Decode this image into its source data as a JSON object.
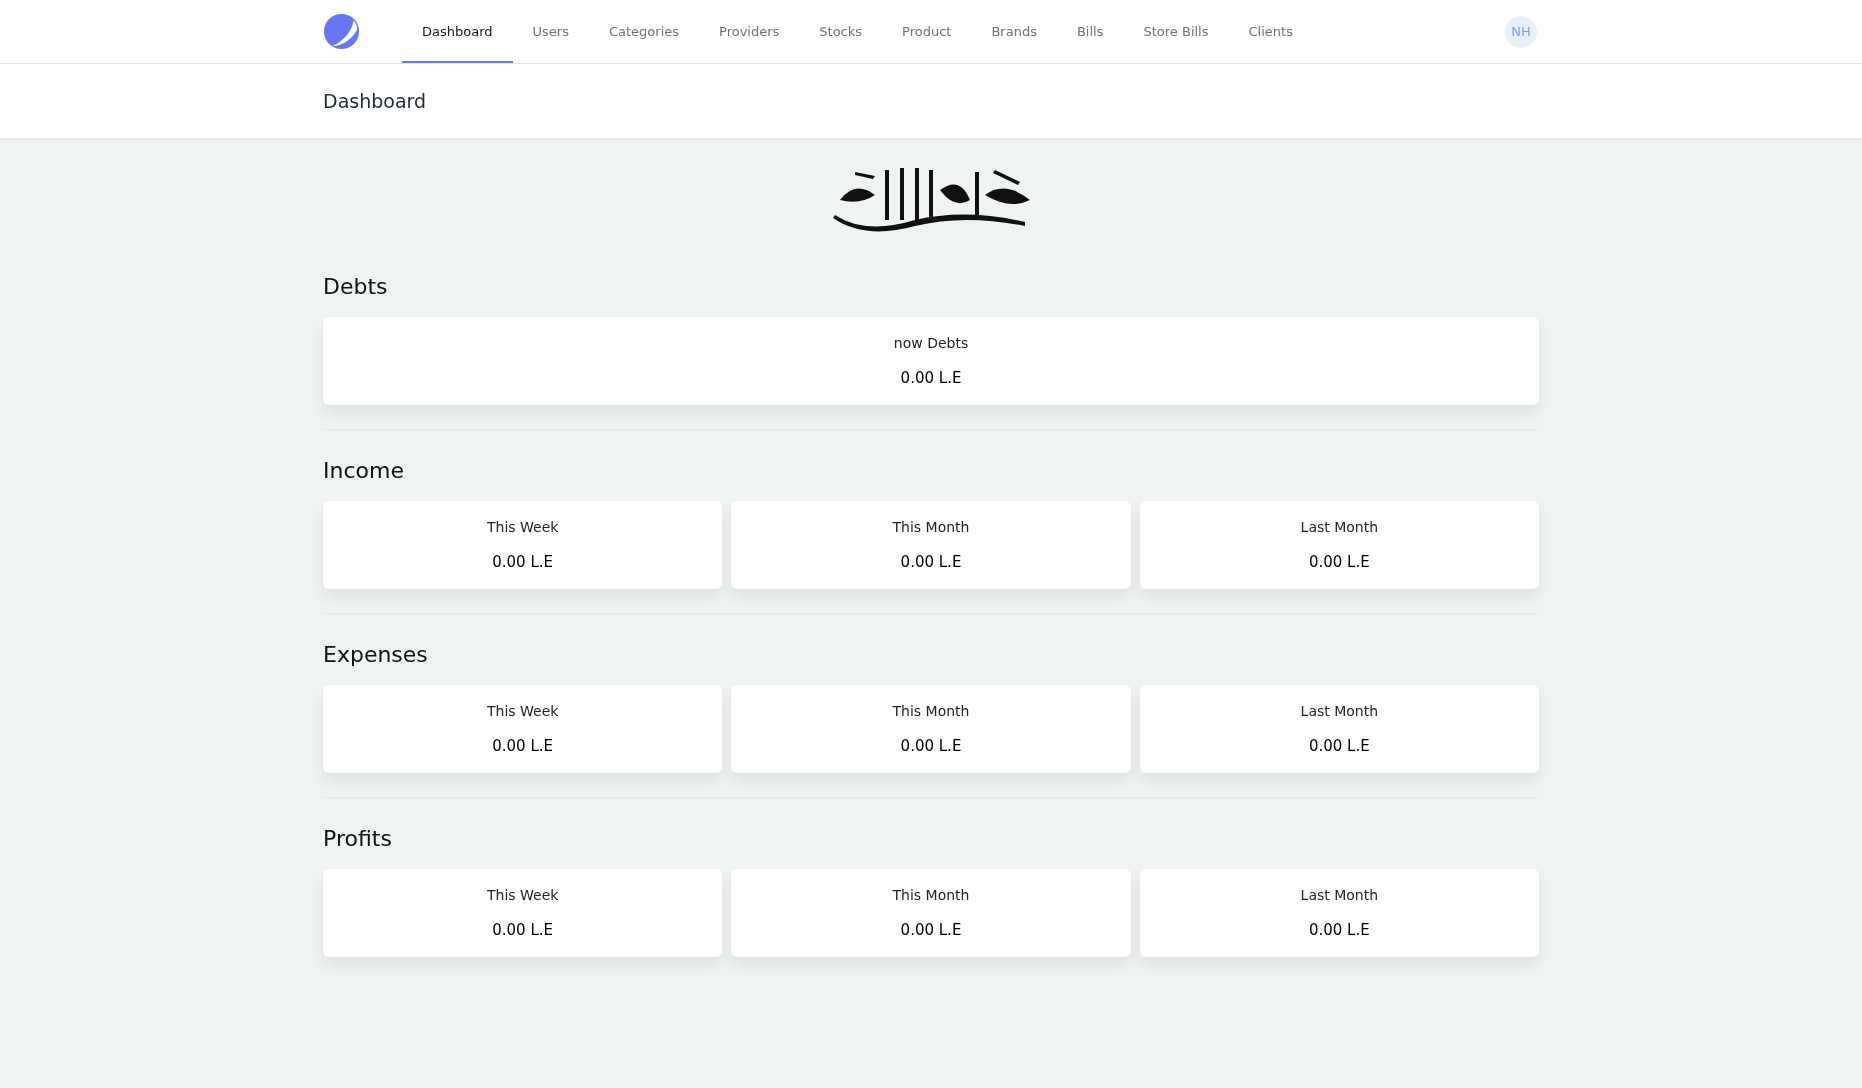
{
  "nav": {
    "tabs": [
      {
        "label": "Dashboard",
        "selected": true
      },
      {
        "label": "Users",
        "selected": false
      },
      {
        "label": "Categories",
        "selected": false
      },
      {
        "label": "Providers",
        "selected": false
      },
      {
        "label": "Stocks",
        "selected": false
      },
      {
        "label": "Product",
        "selected": false
      },
      {
        "label": "Brands",
        "selected": false
      },
      {
        "label": "Bills",
        "selected": false
      },
      {
        "label": "Store Bills",
        "selected": false
      },
      {
        "label": "Clients",
        "selected": false
      }
    ],
    "avatar": "NH"
  },
  "page_title": "Dashboard",
  "sections": [
    {
      "title": "Debts",
      "cards": [
        {
          "label": "now Debts",
          "value": "0.00 L.E"
        }
      ]
    },
    {
      "title": "Income",
      "cards": [
        {
          "label": "This Week",
          "value": "0.00 L.E"
        },
        {
          "label": "This Month",
          "value": "0.00 L.E"
        },
        {
          "label": "Last Month",
          "value": "0.00 L.E"
        }
      ]
    },
    {
      "title": "Expenses",
      "cards": [
        {
          "label": "This Week",
          "value": "0.00 L.E"
        },
        {
          "label": "This Month",
          "value": "0.00 L.E"
        },
        {
          "label": "Last Month",
          "value": "0.00 L.E"
        }
      ]
    },
    {
      "title": "Profits",
      "cards": [
        {
          "label": "This Week",
          "value": "0.00 L.E"
        },
        {
          "label": "This Month",
          "value": "0.00 L.E"
        },
        {
          "label": "Last Month",
          "value": "0.00 L.E"
        }
      ]
    }
  ]
}
